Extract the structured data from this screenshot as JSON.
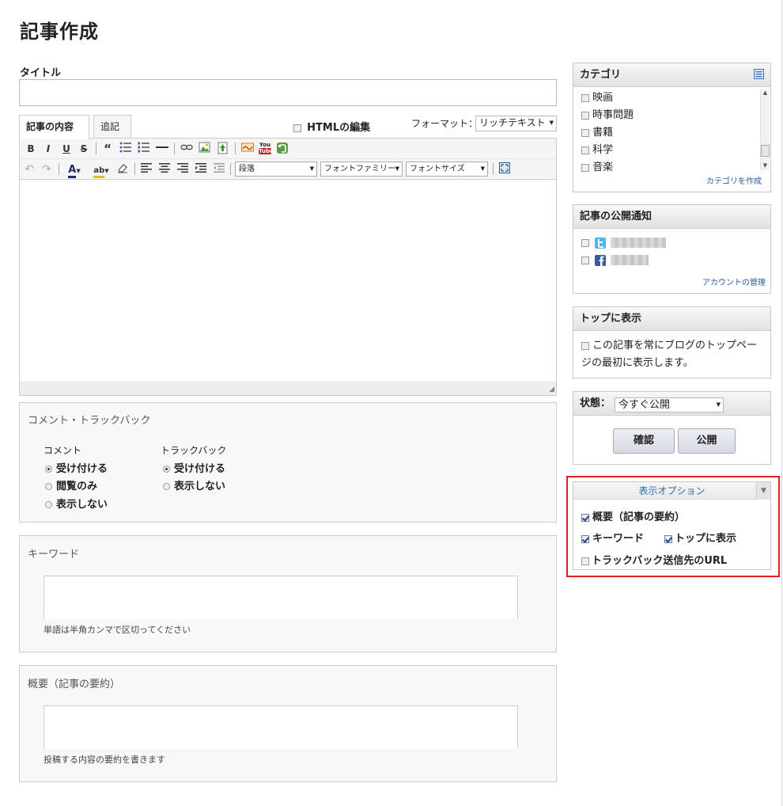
{
  "page": {
    "title": "記事作成"
  },
  "title_field": {
    "label": "タイトル",
    "value": ""
  },
  "editor": {
    "tabs": [
      {
        "label": "記事の内容"
      },
      {
        "label": "追記"
      }
    ],
    "html_edit_label": "HTMLの編集",
    "format_label": "フォーマット：",
    "format_value": "リッチテキスト",
    "toolbar": {
      "bold": "B",
      "italic": "I",
      "underline": "U",
      "strike": "S",
      "quote": "“",
      "youtube_top": "You",
      "youtube_bottom": "Tube",
      "paragraph": "段落",
      "font_family": "フォントファミリー",
      "font_size": "フォントサイズ",
      "text_color": "A",
      "highlight": "ab"
    },
    "content": ""
  },
  "comments_panel": {
    "title": "コメント・トラックバック",
    "comment": {
      "label": "コメント",
      "options": [
        "受け付ける",
        "閲覧のみ",
        "表示しない"
      ],
      "selected": "受け付ける"
    },
    "trackback": {
      "label": "トラックバック",
      "options": [
        "受け付ける",
        "表示しない"
      ],
      "selected": "受け付ける"
    }
  },
  "keyword_panel": {
    "title": "キーワード",
    "value": "",
    "hint": "単語は半角カンマで区切ってください"
  },
  "summary_panel": {
    "title": "概要（記事の要約）",
    "value": "",
    "hint": "投稿する内容の要約を書きます"
  },
  "category_box": {
    "title": "カテゴリ",
    "items": [
      "映画",
      "時事問題",
      "書籍",
      "科学",
      "音楽"
    ],
    "create_link": "カテゴリを作成"
  },
  "notify_box": {
    "title": "記事の公開通知",
    "manage_link": "アカウントの管理"
  },
  "top_box": {
    "title": "トップに表示",
    "line1": "この記事を常にブログのトップペー",
    "line2": "ジの最初に表示します。"
  },
  "publish_box": {
    "status_label": "状態：",
    "status_value": "今すぐ公開",
    "confirm_label": "確認",
    "publish_label": "公開"
  },
  "display_options": {
    "title": "表示オプション",
    "summary": {
      "label": "概要（記事の要約）",
      "checked": true
    },
    "keyword": {
      "label": "キーワード",
      "checked": true
    },
    "show_top": {
      "label": "トップに表示",
      "checked": true
    },
    "trackback_url": {
      "label": "トラックバック送信先のURL",
      "checked": false
    }
  },
  "colors": {
    "accent_red": "#e02020",
    "link_blue": "#2b5a9c"
  }
}
